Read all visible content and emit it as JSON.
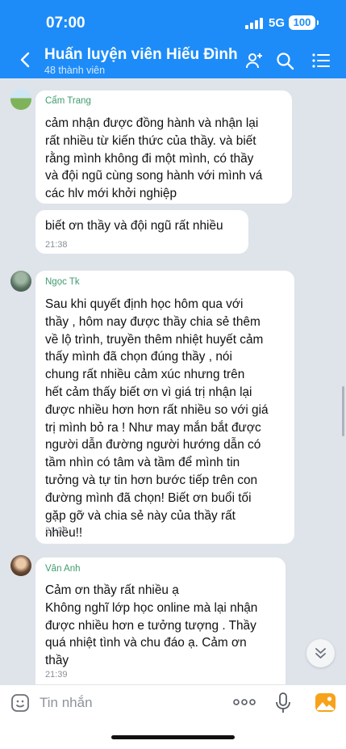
{
  "status_bar": {
    "time": "07:00",
    "network": "5G",
    "battery": "100"
  },
  "header": {
    "title": "Huấn luyện viên Hiếu Đình",
    "subtitle": "48 thành viên",
    "icons": [
      "back-arrow-icon",
      "add-member-icon",
      "search-icon",
      "menu-list-icon"
    ]
  },
  "messages": [
    {
      "sender": "Cẩm Trang",
      "lines": [
        "cảm nhận được đồng hành và nhận lại",
        "rất nhiều từ kiến thức của thầy. và biết",
        "rằng mình không đi một mình, có thầy",
        "và đội ngũ cùng song hành với mình vá",
        "các hlv mới khởi nghiệp"
      ],
      "time": ""
    },
    {
      "sender": "",
      "lines": [
        "biết ơn thầy và đội ngũ rất nhiều"
      ],
      "time": "21:38"
    },
    {
      "sender": "Ngọc Tk",
      "lines": [
        "Sau khi quyết định học hôm qua với",
        "thầy , hôm nay được thầy chia sẻ thêm",
        "về lộ trình, truyền thêm nhiệt huyết cảm",
        "thấy mình đã chọn đúng thầy , nói",
        "chung rất nhiều cảm xúc nhưng trên",
        "hết cảm thấy biết ơn vì giá trị nhận lại",
        "được nhiều hơn hơn rất nhiều so với giá",
        "trị mình bỏ ra ! Như may mắn bắt được",
        "người dẫn đường người hướng dẫn có",
        "tầm nhìn có tâm và tầm để mình tin",
        "tưởng và tự tin hơn bước tiếp trên con",
        "đường mình đã chọn! Biết ơn buổi tối",
        "gặp gỡ và chia sẻ này của thầy rất",
        "nhiều!!"
      ],
      "time": "21:39"
    },
    {
      "sender": "Vân Anh",
      "lines": [
        "Cảm ơn thầy rất nhiều ạ",
        "Không nghĩ lớp học online mà lại nhận",
        "được nhiều hơn e tưởng tượng . Thầy",
        "quá nhiệt tình và chu đáo ạ. Cảm ơn",
        "thầy"
      ],
      "time": "21:39"
    }
  ],
  "input_bar": {
    "placeholder": "Tin nhắn",
    "icons": [
      "sticker-icon",
      "more-options-icon",
      "microphone-icon",
      "photo-icon"
    ]
  },
  "colors": {
    "header": "#1d8cf8",
    "background": "#dfe3ea",
    "sender_name": "#3f9c6e"
  }
}
